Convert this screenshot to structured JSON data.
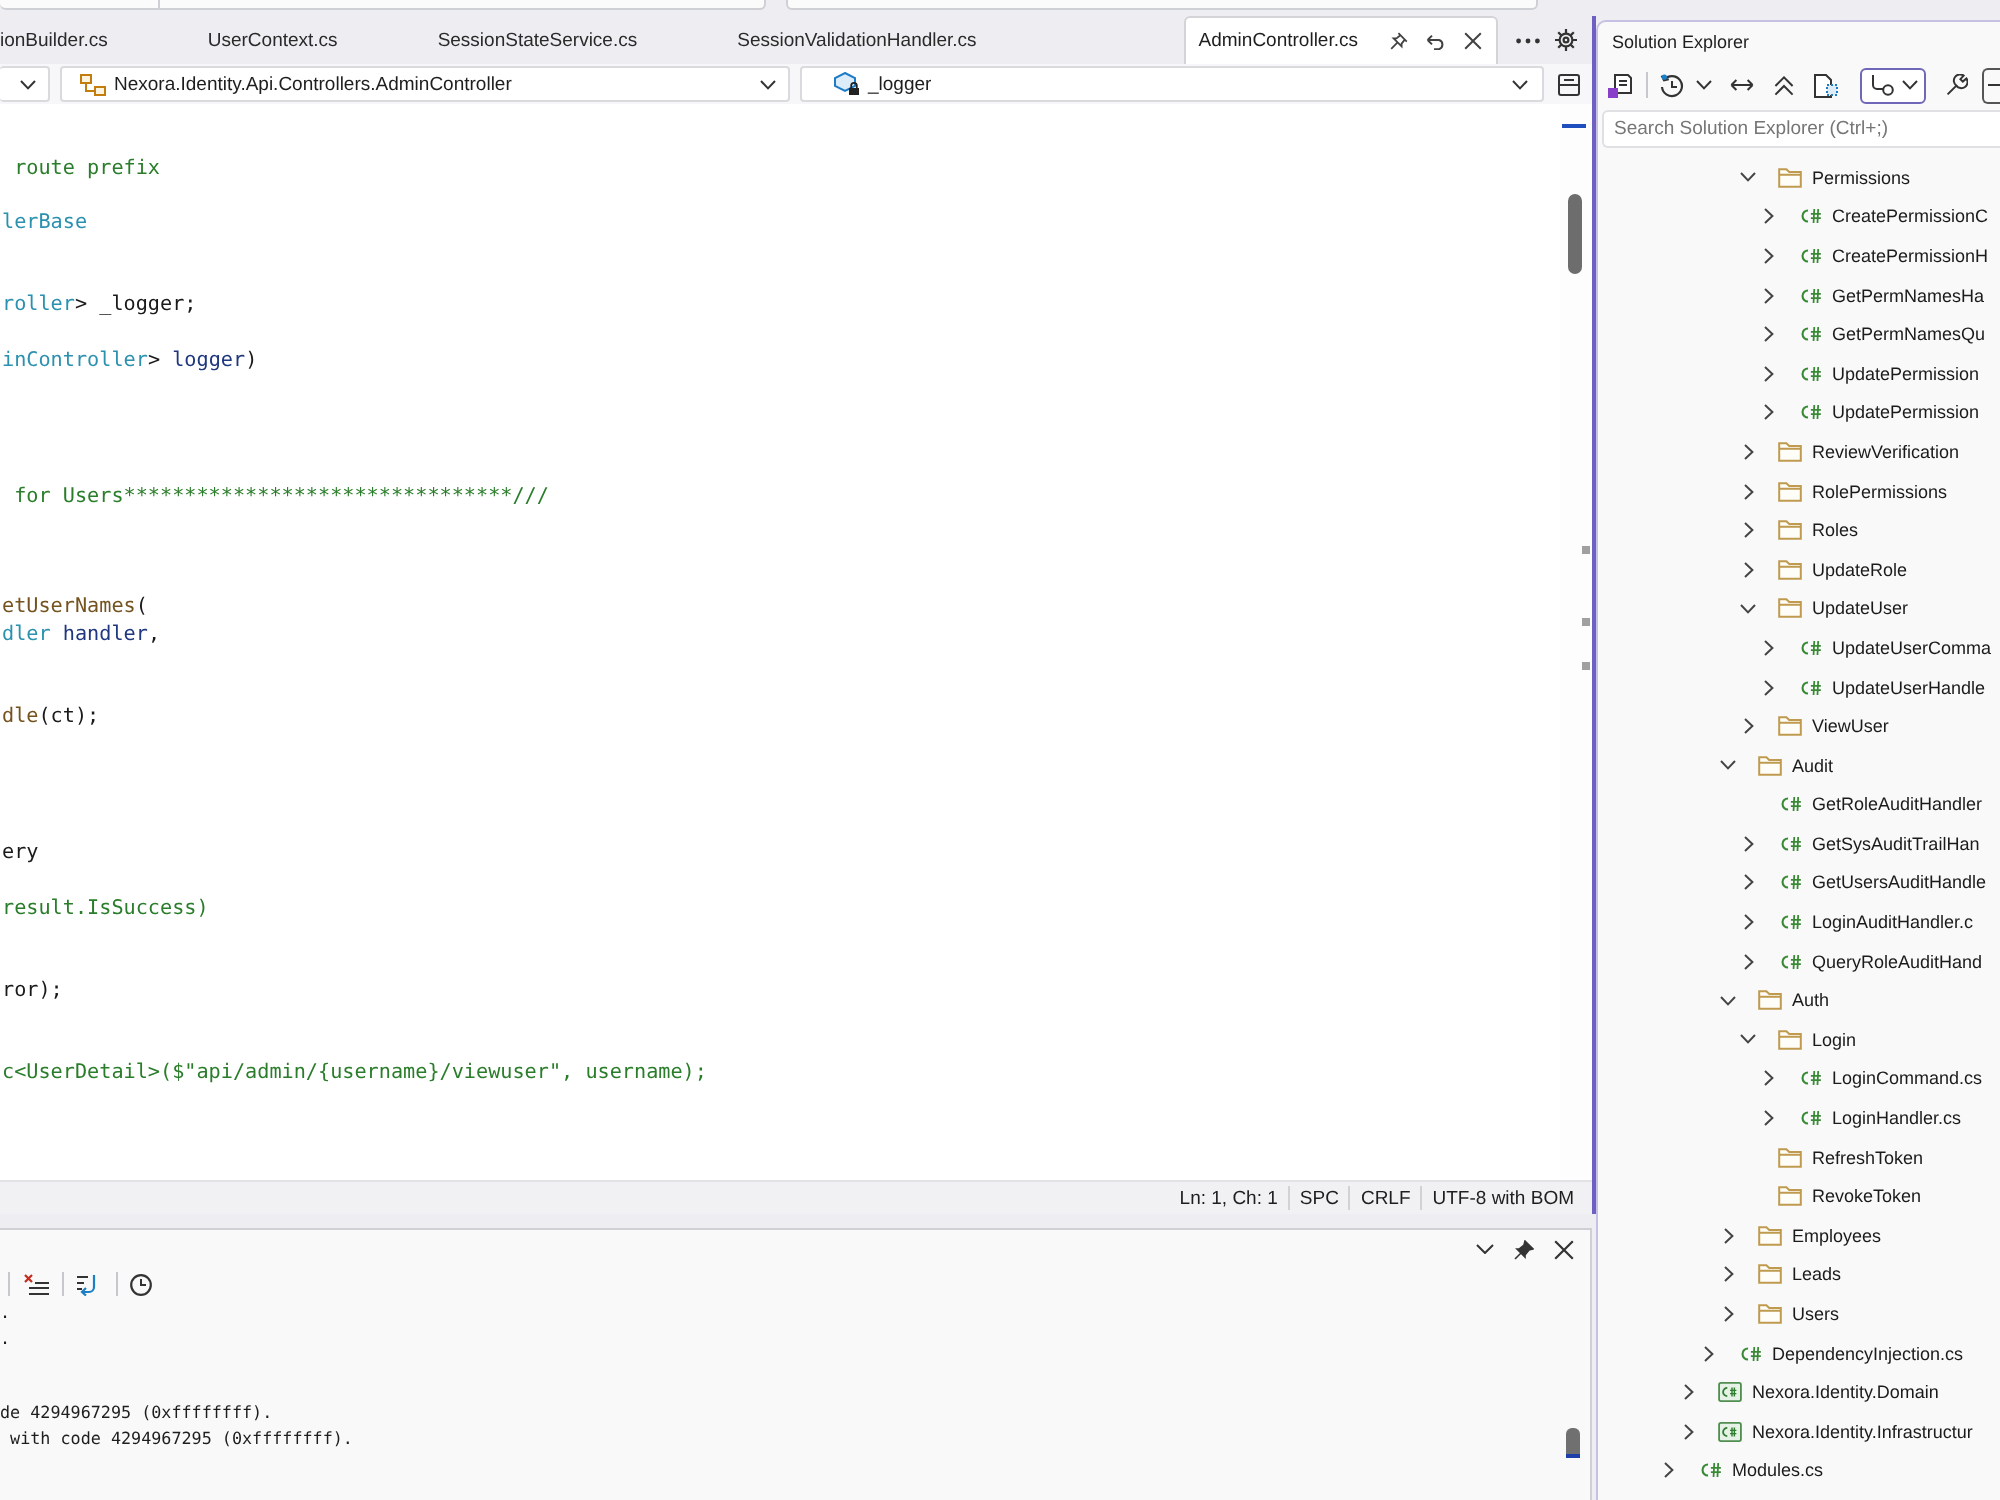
{
  "tabs": [
    {
      "label": "ionBuilder.cs",
      "selected": false
    },
    {
      "label": "UserContext.cs",
      "selected": false
    },
    {
      "label": "SessionStateService.cs",
      "selected": false
    },
    {
      "label": "SessionValidationHandler.cs",
      "selected": false
    },
    {
      "label": "AdminController.cs",
      "selected": true
    }
  ],
  "navigation_bar": {
    "type": "Nexora.Identity.Api.Controllers.AdminController",
    "member": "_logger"
  },
  "editor": {
    "lines": [
      {
        "kind": "code",
        "tokens": [
          {
            "kind": "comment",
            "text": " route prefix"
          }
        ]
      },
      {
        "kind": "blank"
      },
      {
        "kind": "code",
        "tokens": [
          {
            "kind": "type",
            "text": "lerBase"
          }
        ]
      },
      {
        "kind": "blank"
      },
      {
        "kind": "blank"
      },
      {
        "kind": "code",
        "tokens": [
          {
            "kind": "type",
            "text": "roller"
          },
          {
            "kind": "plain",
            "text": "> _logger;"
          }
        ]
      },
      {
        "kind": "blank"
      },
      {
        "kind": "code",
        "tokens": [
          {
            "kind": "type",
            "text": "inController"
          },
          {
            "kind": "plain",
            "text": "> "
          },
          {
            "kind": "param",
            "text": "logger"
          },
          {
            "kind": "plain",
            "text": ")"
          }
        ]
      },
      {
        "kind": "blank"
      },
      {
        "kind": "blank"
      },
      {
        "kind": "blank"
      },
      {
        "kind": "blank"
      },
      {
        "kind": "code",
        "tokens": [
          {
            "kind": "comment",
            "text": " for Users********************************///"
          }
        ]
      },
      {
        "kind": "blank"
      },
      {
        "kind": "blank"
      },
      {
        "kind": "blank"
      },
      {
        "kind": "code",
        "tokens": [
          {
            "kind": "method",
            "text": "etUserNames"
          },
          {
            "kind": "plain",
            "text": "("
          }
        ]
      },
      {
        "kind": "code",
        "tokens": [
          {
            "kind": "type",
            "text": "dler"
          },
          {
            "kind": "param",
            "text": " handler"
          },
          {
            "kind": "plain",
            "text": ","
          }
        ]
      },
      {
        "kind": "blank"
      },
      {
        "kind": "blank"
      },
      {
        "kind": "code",
        "tokens": [
          {
            "kind": "method",
            "text": "dle"
          },
          {
            "kind": "plain",
            "text": "(ct);"
          }
        ]
      },
      {
        "kind": "blank"
      },
      {
        "kind": "blank"
      },
      {
        "kind": "blank"
      },
      {
        "kind": "blank"
      },
      {
        "kind": "code",
        "tokens": [
          {
            "kind": "plain",
            "text": "ery"
          }
        ]
      },
      {
        "kind": "blank"
      },
      {
        "kind": "code",
        "tokens": [
          {
            "kind": "comment",
            "text": "result.IsSuccess)"
          }
        ]
      },
      {
        "kind": "blank"
      },
      {
        "kind": "blank"
      },
      {
        "kind": "code",
        "tokens": [
          {
            "kind": "plain",
            "text": "ror);"
          }
        ]
      },
      {
        "kind": "blank"
      },
      {
        "kind": "blank"
      },
      {
        "kind": "code",
        "tokens": [
          {
            "kind": "comment",
            "text": "c<UserDetail>($\"api/admin/{username}/viewuser\", username);"
          }
        ]
      }
    ]
  },
  "status_bar": [
    "Ln: 1, Ch: 1",
    "SPC",
    "CRLF",
    "UTF-8 with BOM"
  ],
  "output": {
    "lines": [
      {
        "kind": "text",
        "text": "."
      },
      {
        "kind": "text",
        "text": "."
      },
      {
        "kind": "blank"
      },
      {
        "kind": "blank"
      },
      {
        "kind": "text",
        "text": "de 4294967295 (0xffffffff)."
      },
      {
        "kind": "text",
        "text": " with code 4294967295 (0xffffffff)."
      }
    ]
  },
  "solution_explorer": {
    "title": "Solution Explorer",
    "search": {
      "placeholder": "Search Solution Explorer (Ctrl+;)"
    },
    "tree": [
      {
        "children": [
          {
            "children": [
              {
                "children": [
                  {
                    "children": [
                      {
                        "label": "Permissions",
                        "kind": "folder",
                        "expanded": true,
                        "children": [
                          {
                            "label": "CreatePermissionC",
                            "kind": "csharp",
                            "expanded": false
                          },
                          {
                            "label": "CreatePermissionH",
                            "kind": "csharp",
                            "expanded": false
                          },
                          {
                            "label": "GetPermNamesHa",
                            "kind": "csharp",
                            "expanded": false
                          },
                          {
                            "label": "GetPermNamesQu",
                            "kind": "csharp",
                            "expanded": false
                          },
                          {
                            "label": "UpdatePermission",
                            "kind": "csharp",
                            "expanded": false
                          },
                          {
                            "label": "UpdatePermission",
                            "kind": "csharp",
                            "expanded": false
                          }
                        ]
                      },
                      {
                        "label": "ReviewVerification",
                        "kind": "folder",
                        "expanded": false
                      },
                      {
                        "label": "RolePermissions",
                        "kind": "folder",
                        "expanded": false
                      },
                      {
                        "label": "Roles",
                        "kind": "folder",
                        "expanded": false
                      },
                      {
                        "label": "UpdateRole",
                        "kind": "folder",
                        "expanded": false
                      },
                      {
                        "label": "UpdateUser",
                        "kind": "folder",
                        "expanded": true,
                        "children": [
                          {
                            "label": "UpdateUserComma",
                            "kind": "csharp",
                            "expanded": false
                          },
                          {
                            "label": "UpdateUserHandle",
                            "kind": "csharp",
                            "expanded": false
                          }
                        ]
                      },
                      {
                        "label": "ViewUser",
                        "kind": "folder",
                        "expanded": false
                      }
                    ]
                  },
                  {
                    "label": "Audit",
                    "kind": "folder",
                    "expanded": true,
                    "children": [
                      {
                        "label": "GetRoleAuditHandler",
                        "kind": "csharp"
                      },
                      {
                        "label": "GetSysAuditTrailHan",
                        "kind": "csharp",
                        "expanded": false
                      },
                      {
                        "label": "GetUsersAuditHandle",
                        "kind": "csharp",
                        "expanded": false
                      },
                      {
                        "label": "LoginAuditHandler.c",
                        "kind": "csharp",
                        "expanded": false
                      },
                      {
                        "label": "QueryRoleAuditHand",
                        "kind": "csharp",
                        "expanded": false
                      }
                    ]
                  },
                  {
                    "label": "Auth",
                    "kind": "folder",
                    "expanded": true,
                    "children": [
                      {
                        "label": "Login",
                        "kind": "folder",
                        "expanded": true,
                        "children": [
                          {
                            "label": "LoginCommand.cs",
                            "kind": "csharp",
                            "expanded": false
                          },
                          {
                            "label": "LoginHandler.cs",
                            "kind": "csharp",
                            "expanded": false
                          }
                        ]
                      },
                      {
                        "label": "RefreshToken",
                        "kind": "folder"
                      },
                      {
                        "label": "RevokeToken",
                        "kind": "folder"
                      }
                    ]
                  },
                  {
                    "label": "Employees",
                    "kind": "folder",
                    "expanded": false
                  },
                  {
                    "label": "Leads",
                    "kind": "folder",
                    "expanded": false
                  },
                  {
                    "label": "Users",
                    "kind": "folder",
                    "expanded": false
                  }
                ]
              },
              {
                "label": "DependencyInjection.cs",
                "kind": "csharp",
                "expanded": false
              }
            ]
          },
          {
            "label": "Nexora.Identity.Domain",
            "kind": "project",
            "expanded": false
          },
          {
            "label": "Nexora.Identity.Infrastructur",
            "kind": "project",
            "expanded": false
          }
        ]
      },
      {
        "label": "Modules.cs",
        "kind": "csharp",
        "expanded": false
      }
    ]
  }
}
